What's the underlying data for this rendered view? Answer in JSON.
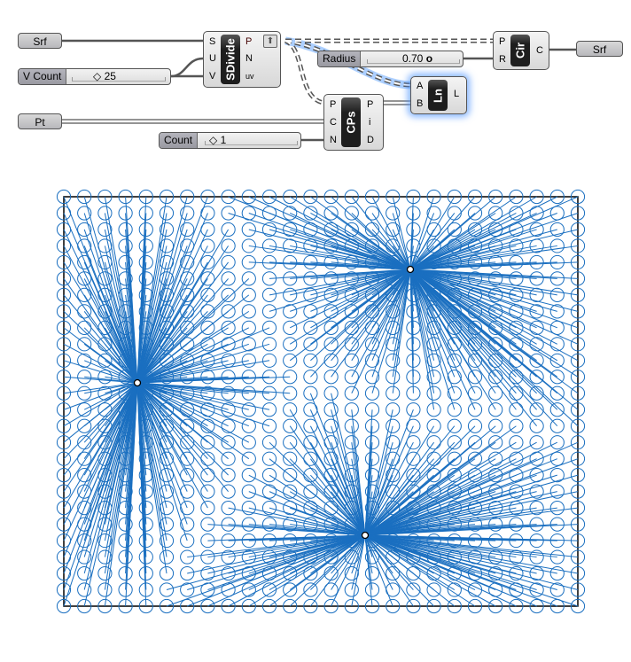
{
  "canvas": {
    "srf_in": {
      "label": "Srf"
    },
    "v_count": {
      "label": "V Count",
      "value": "25"
    },
    "sdivide": {
      "name": "SDivide",
      "inputs": [
        "S",
        "U",
        "V"
      ],
      "outputs": [
        "P",
        "N",
        "uv"
      ],
      "icon": "arrow-up-icon"
    },
    "pt": {
      "label": "Pt"
    },
    "count": {
      "label": "Count",
      "value": "1"
    },
    "cps": {
      "name": "CPs",
      "inputs": [
        "P",
        "C",
        "N"
      ],
      "outputs": [
        "P",
        "i",
        "D"
      ]
    },
    "radius": {
      "label": "Radius",
      "value": "0.70"
    },
    "cir": {
      "name": "Cir",
      "inputs": [
        "P",
        "R"
      ],
      "outputs": [
        "C"
      ]
    },
    "ln": {
      "name": "Ln",
      "inputs": [
        "A",
        "B"
      ],
      "outputs": [
        "L"
      ],
      "selected": true
    },
    "srf_out": {
      "label": "Srf"
    }
  },
  "viewport": {
    "u_divisions": 25,
    "v_divisions": 25,
    "circle_radius": 0.7,
    "closest_count": 1,
    "geometry_color": "#1a6fc0",
    "boundary_color": "#000000"
  }
}
